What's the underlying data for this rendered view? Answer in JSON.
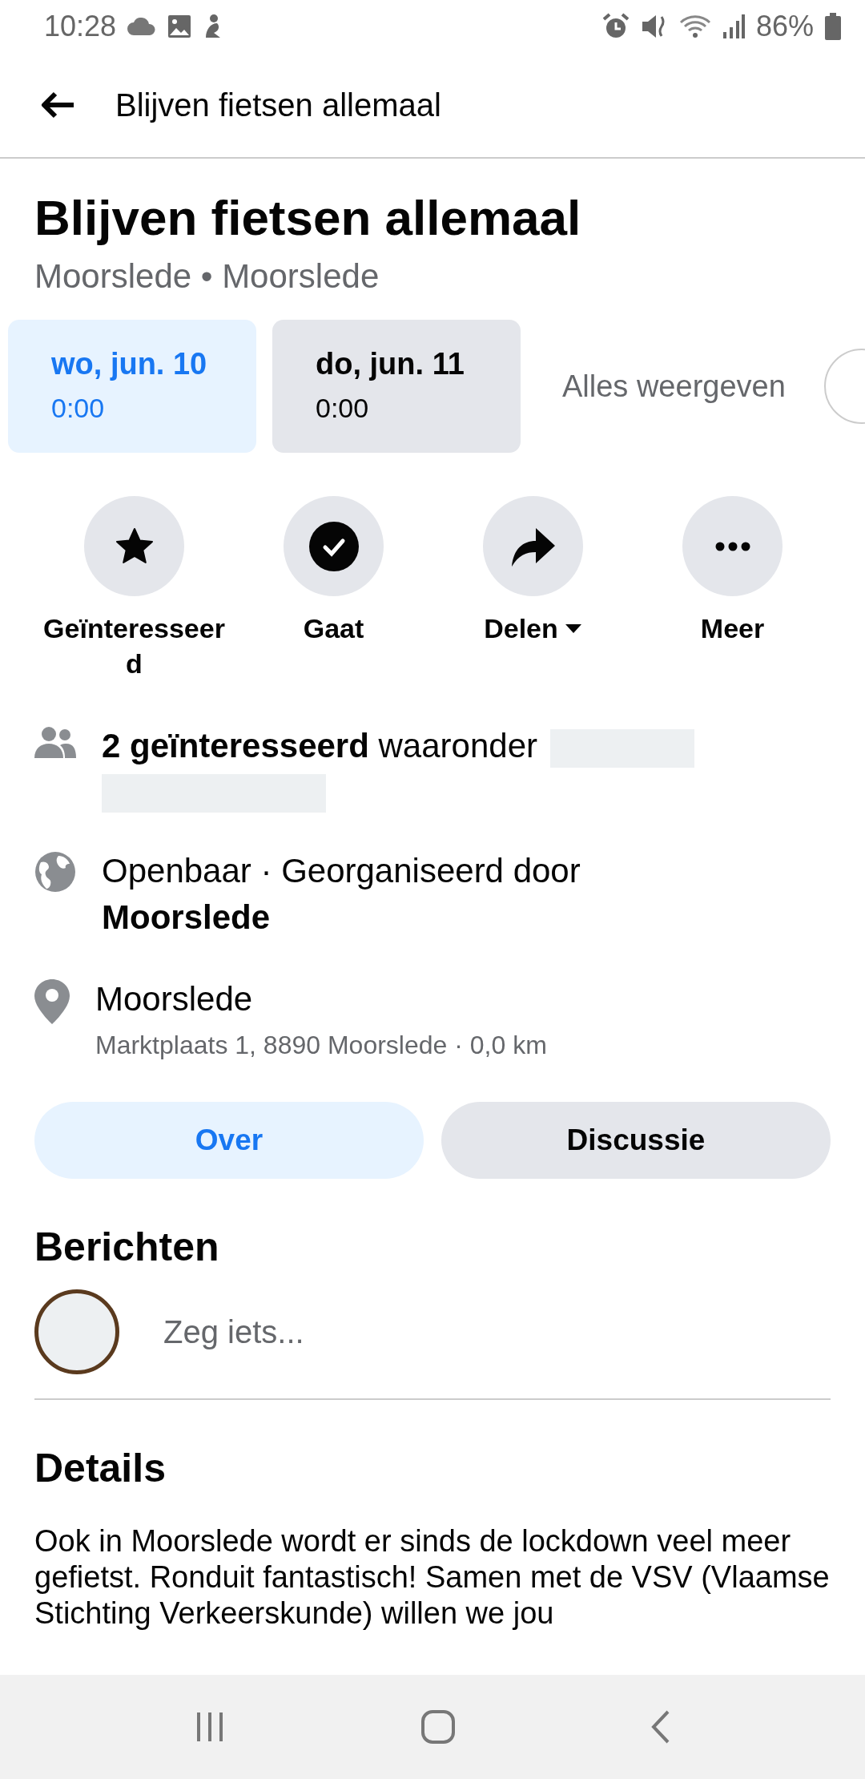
{
  "status_bar": {
    "time": "10:28",
    "battery": "86%"
  },
  "header": {
    "title": "Blijven fietsen allemaal"
  },
  "event": {
    "title": "Blijven fietsen allemaal",
    "subtitle": "Moorslede • Moorslede"
  },
  "dates": [
    {
      "day": "wo, jun. 10",
      "time": "0:00",
      "selected": true
    },
    {
      "day": "do, jun. 11",
      "time": "0:00",
      "selected": false
    }
  ],
  "show_all": "Alles weergeven",
  "actions": [
    {
      "kind": "star",
      "label": "Geïnteresseerd",
      "dropdown": false
    },
    {
      "kind": "check",
      "label": "Gaat",
      "dropdown": false
    },
    {
      "kind": "share",
      "label": "Delen",
      "dropdown": true
    },
    {
      "kind": "more",
      "label": "Meer",
      "dropdown": false
    }
  ],
  "info": [
    {
      "kind": "people",
      "text": "**2 geïnteresseerd** waaronder",
      "redacted": true
    },
    {
      "kind": "globe",
      "text": "Openbaar · Georganiseerd door **Moorslede**",
      "redacted": false
    },
    {
      "kind": "pin",
      "text": "Moorslede",
      "subtext": "Marktplaats 1, 8890 Moorslede · 0,0 km",
      "redacted": false
    }
  ],
  "tabs": [
    {
      "label": "Over",
      "selected": true
    },
    {
      "label": "Discussie",
      "selected": false
    }
  ],
  "posts": {
    "heading": "Berichten",
    "placeholder": "Zeg iets..."
  },
  "details": {
    "heading": "Details",
    "text": "Ook in Moorslede wordt er sinds de lockdown veel meer gefietst. Ronduit fantastisch! Samen met de VSV (Vlaamse Stichting Verkeerskunde) willen we jou"
  }
}
